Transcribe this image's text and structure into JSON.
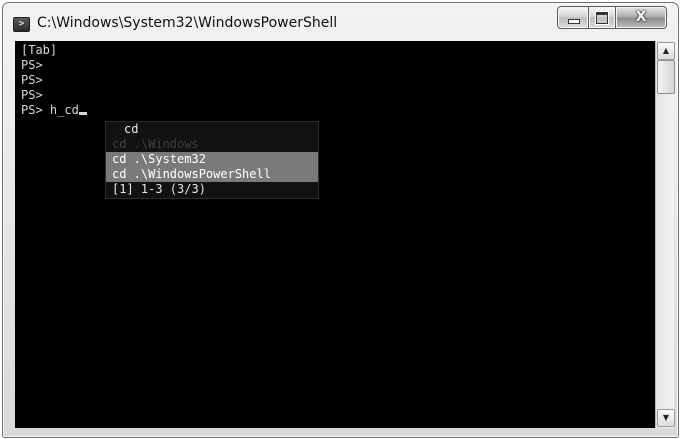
{
  "window": {
    "title": "C:\\Windows\\System32\\WindowsPowerShell",
    "icon": "powershell-icon",
    "controls": {
      "minimize": "minimize-icon",
      "maximize": "maximize-icon",
      "close": "X"
    }
  },
  "console": {
    "lines": [
      "[Tab]",
      "PS>",
      "PS>",
      "PS>",
      "PS> h_cd"
    ],
    "background": "#000000",
    "foreground": "#d6d6d6"
  },
  "completion_popup": {
    "filter": "cd",
    "items": [
      "cd .\\Windows",
      "cd .\\System32",
      "cd .\\WindowsPowerShell"
    ],
    "status": "[1] 1-3 (3/3)",
    "selection_color": "#7a7a7a"
  },
  "scrollbar": {
    "up": "▲",
    "down": "▼"
  }
}
